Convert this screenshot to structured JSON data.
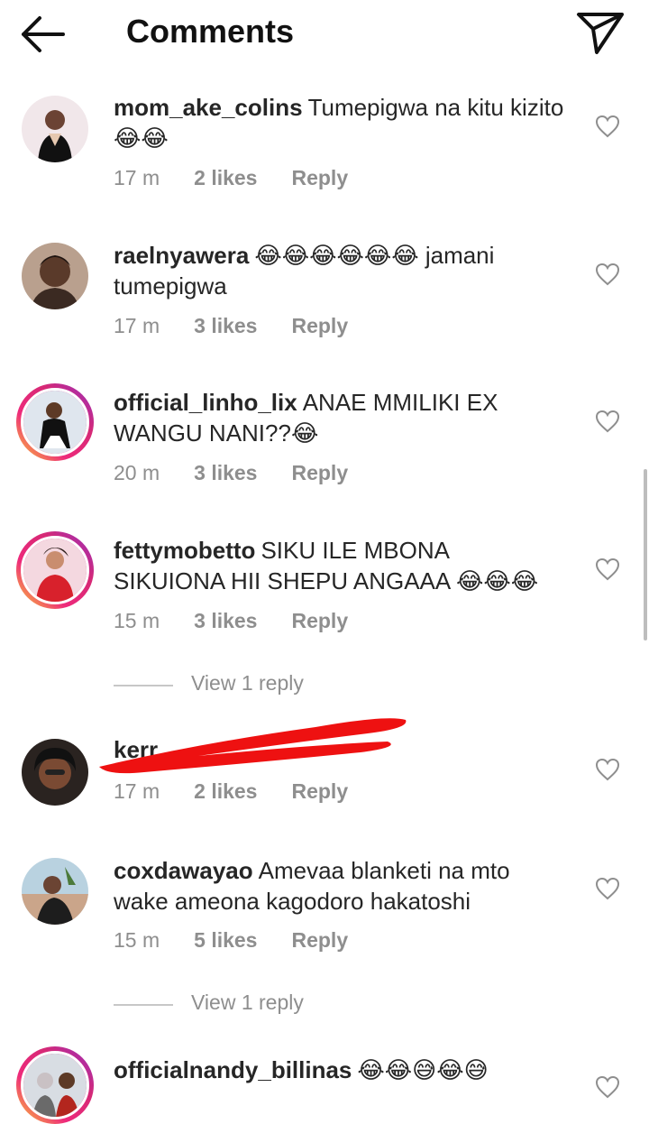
{
  "header": {
    "title": "Comments",
    "back_icon": "arrow-left-icon",
    "send_icon": "paper-plane-icon"
  },
  "comments": [
    {
      "username": "mom_ake_colins",
      "text": "Tumepigwa na kitu kizito😂😂",
      "time": "17 m",
      "likes": "2 likes",
      "reply": "Reply"
    },
    {
      "username": "raelnyawera",
      "text": "😂😂😂😂😂😂 jamani tumepigwa",
      "time": "17 m",
      "likes": "3 likes",
      "reply": "Reply"
    },
    {
      "username": "official_linho_lix",
      "text": "ANAE MMILIKI EX WANGU NANI??😂",
      "time": "20 m",
      "likes": "3 likes",
      "reply": "Reply"
    },
    {
      "username": "fettymobetto",
      "text": "SIKU ILE MBONA SIKUIONA HII SHEPU ANGAAA 😂😂😂",
      "time": "15 m",
      "likes": "3 likes",
      "reply": "Reply",
      "view_replies": "View 1 reply"
    },
    {
      "username": "kerr",
      "text": "",
      "time": "17 m",
      "likes": "2 likes",
      "reply": "Reply"
    },
    {
      "username": "coxdawayao",
      "text": "Amevaa blanketi na mto wake ameona kagodoro hakatoshi",
      "time": "15 m",
      "likes": "5 likes",
      "reply": "Reply",
      "view_replies": "View 1 reply"
    },
    {
      "username": "officialnandy_billinas",
      "text": "😂😂😅😂😅",
      "time": "",
      "likes": "",
      "reply": ""
    }
  ],
  "colors": {
    "muted": "#8e8e8e",
    "text": "#262626",
    "redaction": "#ee1111"
  }
}
